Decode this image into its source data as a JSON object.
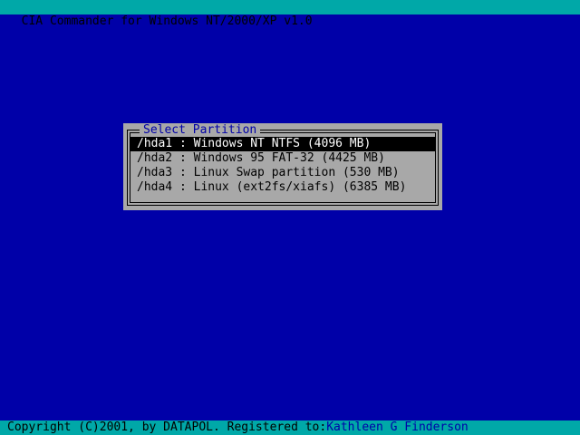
{
  "app": {
    "title": "CIA Commander for Windows NT/2000/XP v1.0"
  },
  "dialog": {
    "title": "Select Partition",
    "selected_index": 0,
    "partitions": [
      {
        "label": "/hda1 : Windows NT NTFS (4096 MB)"
      },
      {
        "label": "/hda2 : Windows 95 FAT-32 (4425 MB)"
      },
      {
        "label": "/hda3 : Linux Swap partition (530 MB)"
      },
      {
        "label": "/hda4 : Linux (ext2fs/xiafs) (6385 MB)"
      }
    ]
  },
  "status": {
    "copyright": "Copyright (C)2001, by DATAPOL. Registered to:",
    "registered_name": "Kathleen G Finderson"
  },
  "colors": {
    "background": "#0000a8",
    "bar": "#00a8a8",
    "dialog": "#a8a8a8",
    "selection": "#000000"
  }
}
